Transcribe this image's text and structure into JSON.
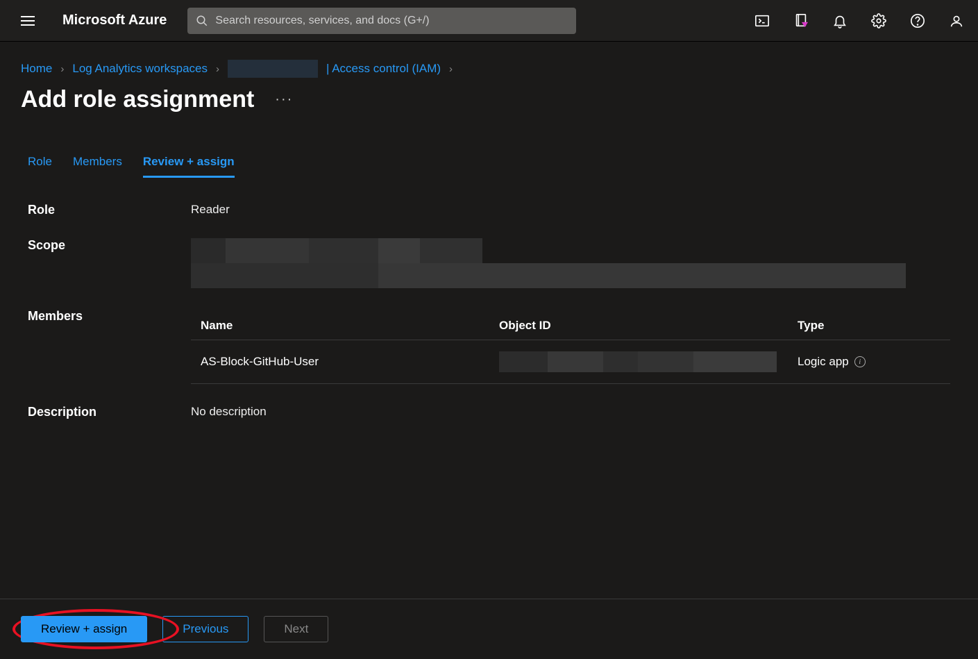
{
  "header": {
    "brand": "Microsoft Azure",
    "search_placeholder": "Search resources, services, and docs (G+/)"
  },
  "breadcrumb": {
    "home": "Home",
    "workspaces": "Log Analytics workspaces",
    "iam": "| Access control (IAM)"
  },
  "page": {
    "title": "Add role assignment"
  },
  "tabs": {
    "role": "Role",
    "members": "Members",
    "review": "Review + assign"
  },
  "details": {
    "role_label": "Role",
    "role_value": "Reader",
    "scope_label": "Scope",
    "members_label": "Members",
    "desc_label": "Description",
    "desc_value": "No description"
  },
  "members_table": {
    "col_name": "Name",
    "col_oid": "Object ID",
    "col_type": "Type",
    "rows": [
      {
        "name": "AS-Block-GitHub-User",
        "type": "Logic app"
      }
    ]
  },
  "footer": {
    "review": "Review + assign",
    "previous": "Previous",
    "next": "Next"
  }
}
